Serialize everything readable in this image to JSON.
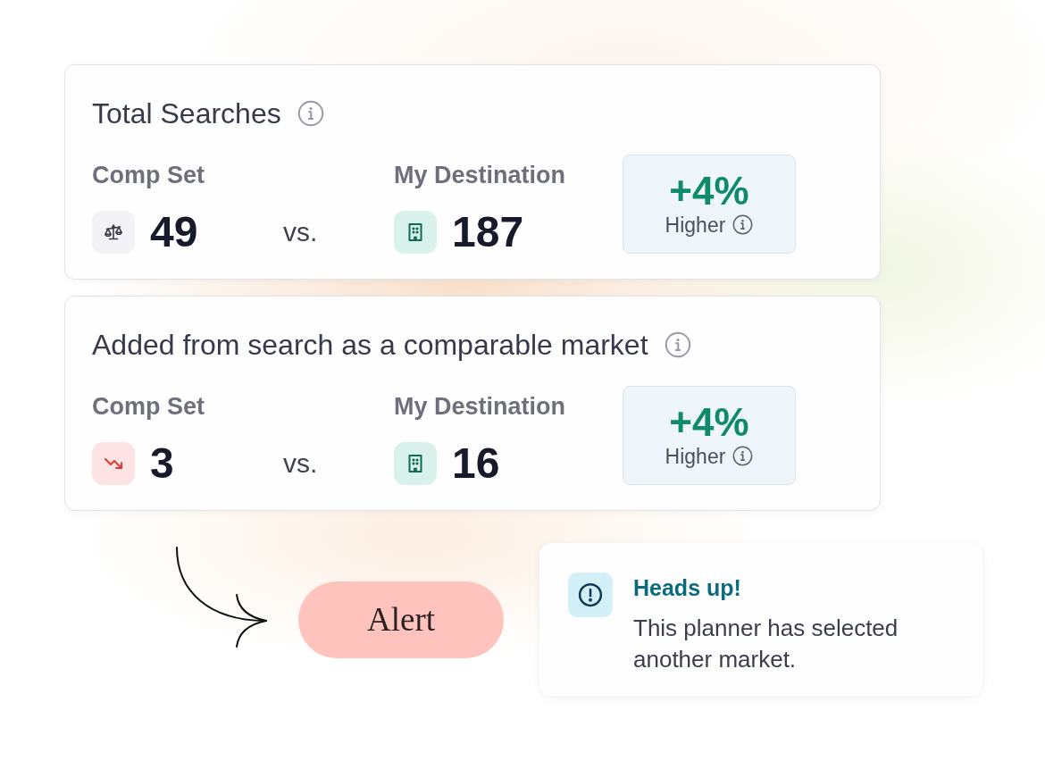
{
  "cards": [
    {
      "title": "Total Searches",
      "comp_set": {
        "label": "Comp Set",
        "value": "49",
        "kind": "neutral"
      },
      "separator": "vs.",
      "my_destination": {
        "label": "My Destination",
        "value": "187"
      },
      "change": {
        "value": "+4%",
        "label": "Higher"
      }
    },
    {
      "title": "Added from search as a comparable market",
      "comp_set": {
        "label": "Comp Set",
        "value": "3",
        "kind": "decline"
      },
      "separator": "vs.",
      "my_destination": {
        "label": "My Destination",
        "value": "16"
      },
      "change": {
        "value": "+4%",
        "label": "Higher"
      }
    }
  ],
  "alert_tag": {
    "label": "Alert"
  },
  "notice": {
    "title": "Heads up!",
    "message": "This planner has selected another market."
  }
}
